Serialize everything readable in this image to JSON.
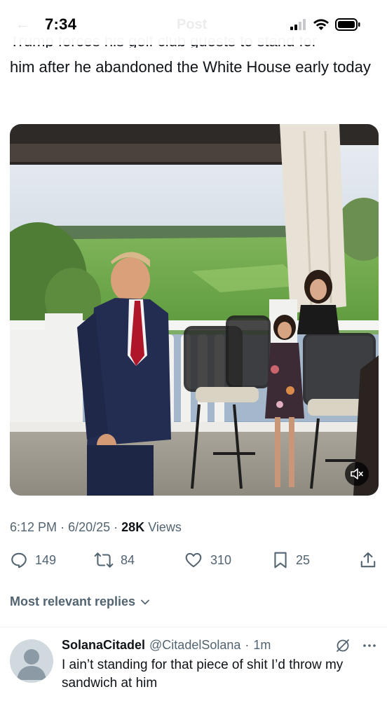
{
  "status_bar": {
    "time": "7:34",
    "faded_title": "Post",
    "icons": [
      "signal-icon",
      "wifi-icon",
      "battery-icon"
    ]
  },
  "tweet": {
    "cut_line": "Trump forces his golf club guests to stand for",
    "text": "him after he abandoned the White House early today",
    "media": {
      "type": "video",
      "mute_icon": "speaker-muted-icon"
    },
    "time": "6:12 PM",
    "date": "6/20/25",
    "separator": "·",
    "views_count": "28K",
    "views_label": "Views"
  },
  "actions": {
    "replies": "149",
    "reposts": "84",
    "likes": "310",
    "bookmarks": "25"
  },
  "replies_section": {
    "sort_label": "Most relevant replies"
  },
  "reply": {
    "name": "SolanaCitadel",
    "handle": "@CitadelSolana",
    "separator": "·",
    "time": "1m",
    "text": "I ain’t standing for that piece of shit I’d throw my sandwich at him"
  },
  "colors": {
    "text_primary": "#0f1419",
    "text_secondary": "#536471",
    "divider": "#eff3f4",
    "avatar_bg": "#cfd9de"
  }
}
